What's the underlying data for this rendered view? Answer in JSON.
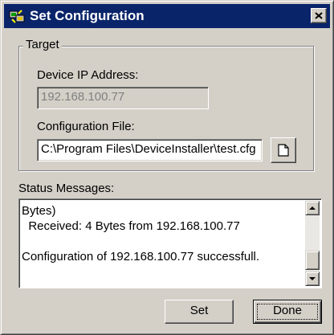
{
  "window": {
    "title": "Set Configuration",
    "close_glyph": "✕"
  },
  "target_group": {
    "legend": "Target",
    "ip_label": "Device IP Address:",
    "ip_value": "192.168.100.77",
    "config_label": "Configuration File:",
    "config_value": "C:\\Program Files\\DeviceInstaller\\test.cfg"
  },
  "status": {
    "label": "Status Messages:",
    "lines": [
      "Bytes)",
      "  Received: 4 Bytes from 192.168.100.77",
      "",
      "Configuration of 192.168.100.77 successfull."
    ]
  },
  "buttons": {
    "set": "Set",
    "done": "Done"
  },
  "icons": {
    "app": "devices-app-icon",
    "browse": "blank-document-icon"
  },
  "colors": {
    "title_bar": "#0a246a",
    "face": "#d4d0c8",
    "disabled_text": "#808080"
  }
}
